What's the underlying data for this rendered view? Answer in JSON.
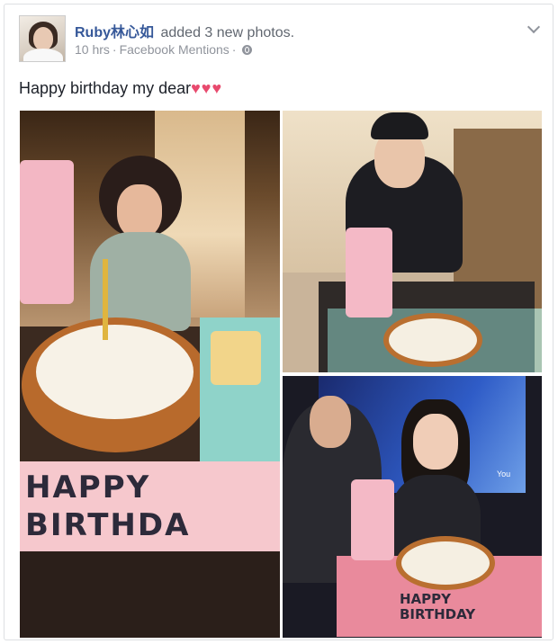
{
  "post": {
    "author": "Ruby林心如",
    "action": "added 3 new photos.",
    "time": "10 hrs",
    "separator": "·",
    "source": "Facebook Mentions",
    "caption": "Happy birthday my dear",
    "caption_emoji": "♥♥♥",
    "privacy_icon": "globe-icon",
    "menu_icon": "chevron-down-icon"
  },
  "photos": {
    "photo1_banner": "HAPPY\nBIRTHDA",
    "photo3_screen_text": "You",
    "photo3_banner": "HAPPY\nBIRTHDAY"
  },
  "colors": {
    "link": "#365899",
    "meta": "#90949c",
    "heart": "#e84a6e"
  }
}
